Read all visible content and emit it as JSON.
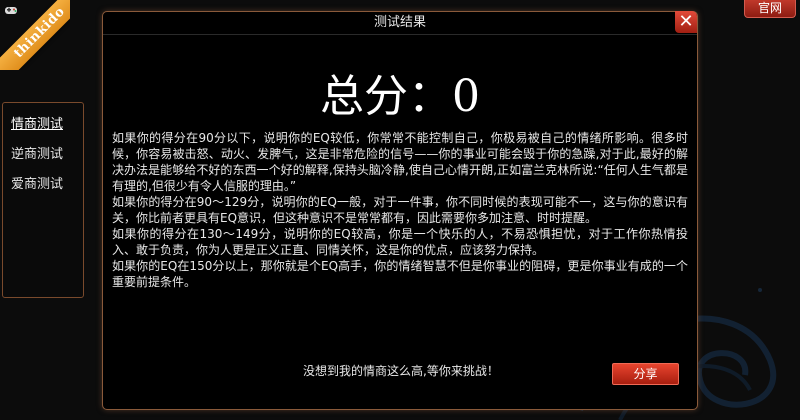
{
  "brand": {
    "ribbon_text": "thinkido",
    "official_label": "官网"
  },
  "menu": {
    "items": [
      {
        "label": "情商测试",
        "active": true
      },
      {
        "label": "逆商测试",
        "active": false
      },
      {
        "label": "爱商测试",
        "active": false
      }
    ]
  },
  "dialog": {
    "title": "测试结果",
    "close_symbol": "✕",
    "score_label": "总分：",
    "score_value": "0",
    "paragraphs": [
      "如果你的得分在90分以下，说明你的EQ较低，你常常不能控制自己，你极易被自己的情绪所影响。很多时候，你容易被击怒、动火、发脾气，这是非常危险的信号——你的事业可能会毁于你的急躁,对于此,最好的解决办法是能够给不好的东西一个好的解释,保持头脑冷静,使自己心情开朗,正如富兰克林所说:“任何人生气都是有理的,但很少有令人信服的理由。”",
      "如果你的得分在90～129分，说明你的EQ一般，对于一件事，你不同时候的表现可能不一，这与你的意识有关，你比前者更具有EQ意识，但这种意识不是常常都有，因此需要你多加注意、时时提醒。",
      "如果你的得分在130～149分，说明你的EQ较高，你是一个快乐的人，不易恐惧担忧，对于工作你热情投入、敢于负责，你为人更是正义正直、同情关怀，这是你的优点，应该努力保持。",
      "如果你的EQ在150分以上，那你就是个EQ高手，你的情绪智慧不但是你事业的阻碍，更是你事业有成的一个重要前提条件。"
    ],
    "footer_text": "没想到我的情商这么高,等你来挑战！",
    "share_label": "分享"
  },
  "colors": {
    "accent_red": "#c0392b",
    "ribbon_orange": "#f0a030",
    "border_brown": "#8a5a3a"
  },
  "icons": {
    "close": "close-icon",
    "game": "game-controller-icon"
  }
}
